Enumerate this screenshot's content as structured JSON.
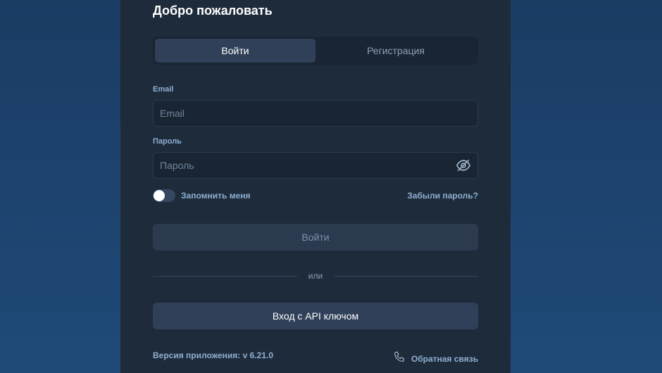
{
  "form": {
    "title": "Добро пожаловать",
    "tabs": [
      {
        "label": "Войти",
        "active": true
      },
      {
        "label": "Регистрация",
        "active": false
      }
    ],
    "email": {
      "label": "Email",
      "placeholder": "Email",
      "value": ""
    },
    "password": {
      "label": "Пароль",
      "placeholder": "Пароль",
      "value": "",
      "icon": "eye-off-icon"
    },
    "remember": {
      "label": "Запомнить меня",
      "checked": false
    },
    "forgot_label": "Забыли пароль?",
    "login_button": "Войти",
    "divider_text": "или",
    "api_button": "Вход с API ключом"
  },
  "footer": {
    "version": "Версия приложения: v 6.21.0",
    "feedback_label": "Обратная связь",
    "feedback_icon": "phone-icon"
  },
  "colors": {
    "background": "#1f4a78",
    "panel": "#1e2b3b",
    "accent_text": "#8fb0d2"
  }
}
